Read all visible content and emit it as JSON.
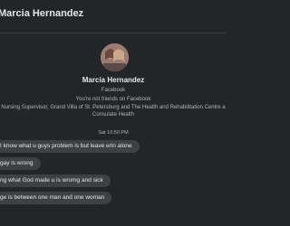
{
  "header": {
    "contact_name": "Marcia Hernandez"
  },
  "profile": {
    "name": "Marcia Hernandez",
    "platform": "Facebook",
    "friend_status": "You're not friends on Facebook",
    "work_line_1": "Nursing Supervisor, Grand Villa of St. Petersburg and The Health and Rehabilitation Centre a",
    "work_line_2": "Consulate Health"
  },
  "thread": {
    "timestamp": "Sat 10:50 PM",
    "messages": [
      "I know what u guys problem is but leave erin alone",
      "gay is wrong",
      "ng what God made u is wromg and sick",
      "ge is between one man and one woman"
    ]
  }
}
